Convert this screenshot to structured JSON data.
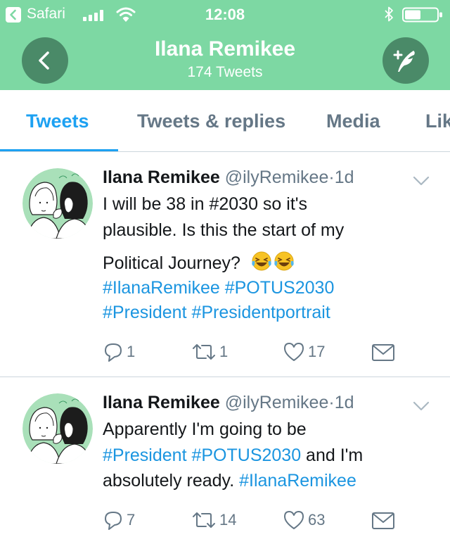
{
  "status_bar": {
    "app_name": "Safari",
    "time": "12:08",
    "icons": [
      "back-to-app-icon",
      "signal-icon",
      "wifi-icon",
      "bluetooth-icon",
      "battery-icon"
    ]
  },
  "nav": {
    "title": "Ilana Remikee",
    "subtitle": "174 Tweets",
    "icons": [
      "back-arrow-icon",
      "compose-tweet-icon"
    ]
  },
  "tabs": [
    {
      "label": "Tweets",
      "active": true
    },
    {
      "label": "Tweets & replies",
      "active": false
    },
    {
      "label": "Media",
      "active": false
    },
    {
      "label": "Lik",
      "active": false
    }
  ],
  "colors": {
    "header": "#7dd8a3",
    "header_button": "#4a8a68",
    "accent": "#1da1f2",
    "hashtag": "#1b95e0",
    "secondary_text": "#657786"
  },
  "tweets": [
    {
      "name": "Ilana Remikee",
      "handle": "@ilyRemikee",
      "separator": "·",
      "time": "1d",
      "text_1": "I will be 38 in #2030 so it's",
      "text_2": "plausible. Is this the start of my",
      "text_3": "Political Journey?",
      "emojis": [
        "laughing-tears-emoji",
        "laughing-tears-emoji"
      ],
      "hashtags_1": "#IlanaRemikee #POTUS2030",
      "hashtags_2": "#President #Presidentportrait",
      "replies": "1",
      "retweets": "1",
      "likes": "17"
    },
    {
      "name": "Ilana Remikee",
      "handle": "@ilyRemikee",
      "separator": "·",
      "time": "1d",
      "text_1": "Apparently I'm going to be",
      "hashtags_line2": "#President #POTUS2030",
      "text_line2_tail": " and I'm",
      "text_line3_head": "absolutely ready. ",
      "hashtags_line3": "#IlanaRemikee",
      "replies": "7",
      "retweets": "14",
      "likes": "63"
    }
  ]
}
